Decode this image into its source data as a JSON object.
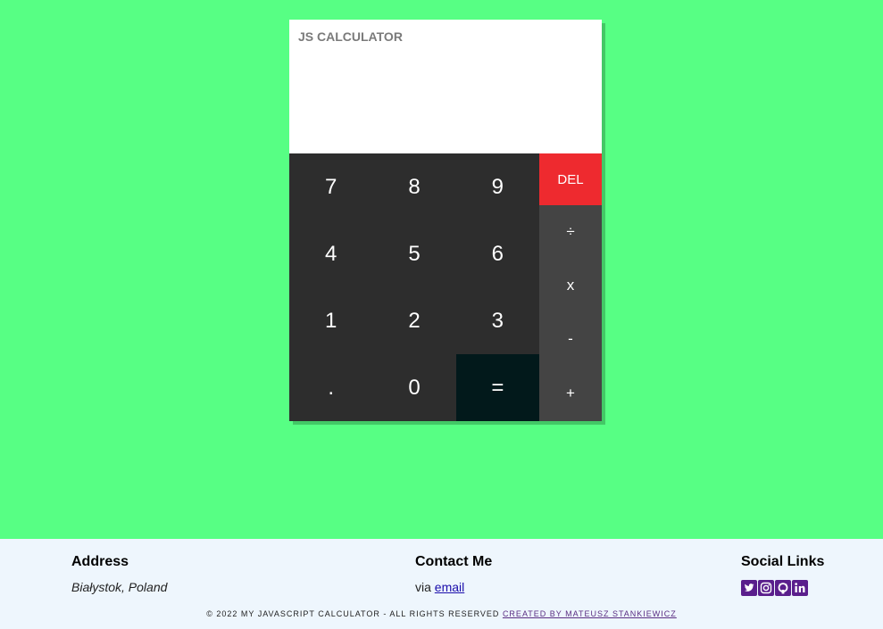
{
  "calculator": {
    "title": "JS CALCULATOR",
    "display_value": "",
    "digit_keys": [
      "7",
      "8",
      "9",
      "4",
      "5",
      "6",
      "1",
      "2",
      "3",
      ".",
      "0",
      "="
    ],
    "operator_keys": {
      "del": "DEL",
      "divide": "÷",
      "multiply": "x",
      "subtract": "-",
      "add": "+"
    }
  },
  "footer": {
    "address_heading": "Address",
    "address_text": "Białystok, Poland",
    "contact_heading": "Contact Me",
    "contact_prefix": "via ",
    "contact_link": "email",
    "social_heading": "Social Links",
    "social_icons": [
      "twitter-icon",
      "instagram-icon",
      "github-icon",
      "linkedin-icon"
    ],
    "copyright_text": "© 2022 MY JAVASCRIPT CALCULATOR - ALL RIGHTS RESERVED ",
    "credit_link": "CREATED BY MATEUSZ STANKIEWICZ"
  },
  "colors": {
    "page_background": "#57ff84",
    "keypad": "#2d2d2d",
    "operator_column": "#444444",
    "delete_key": "#ee2a2f",
    "equals_key": "#02191b",
    "footer_background": "#eef6fd",
    "social_icon": "#5a1e8c"
  }
}
